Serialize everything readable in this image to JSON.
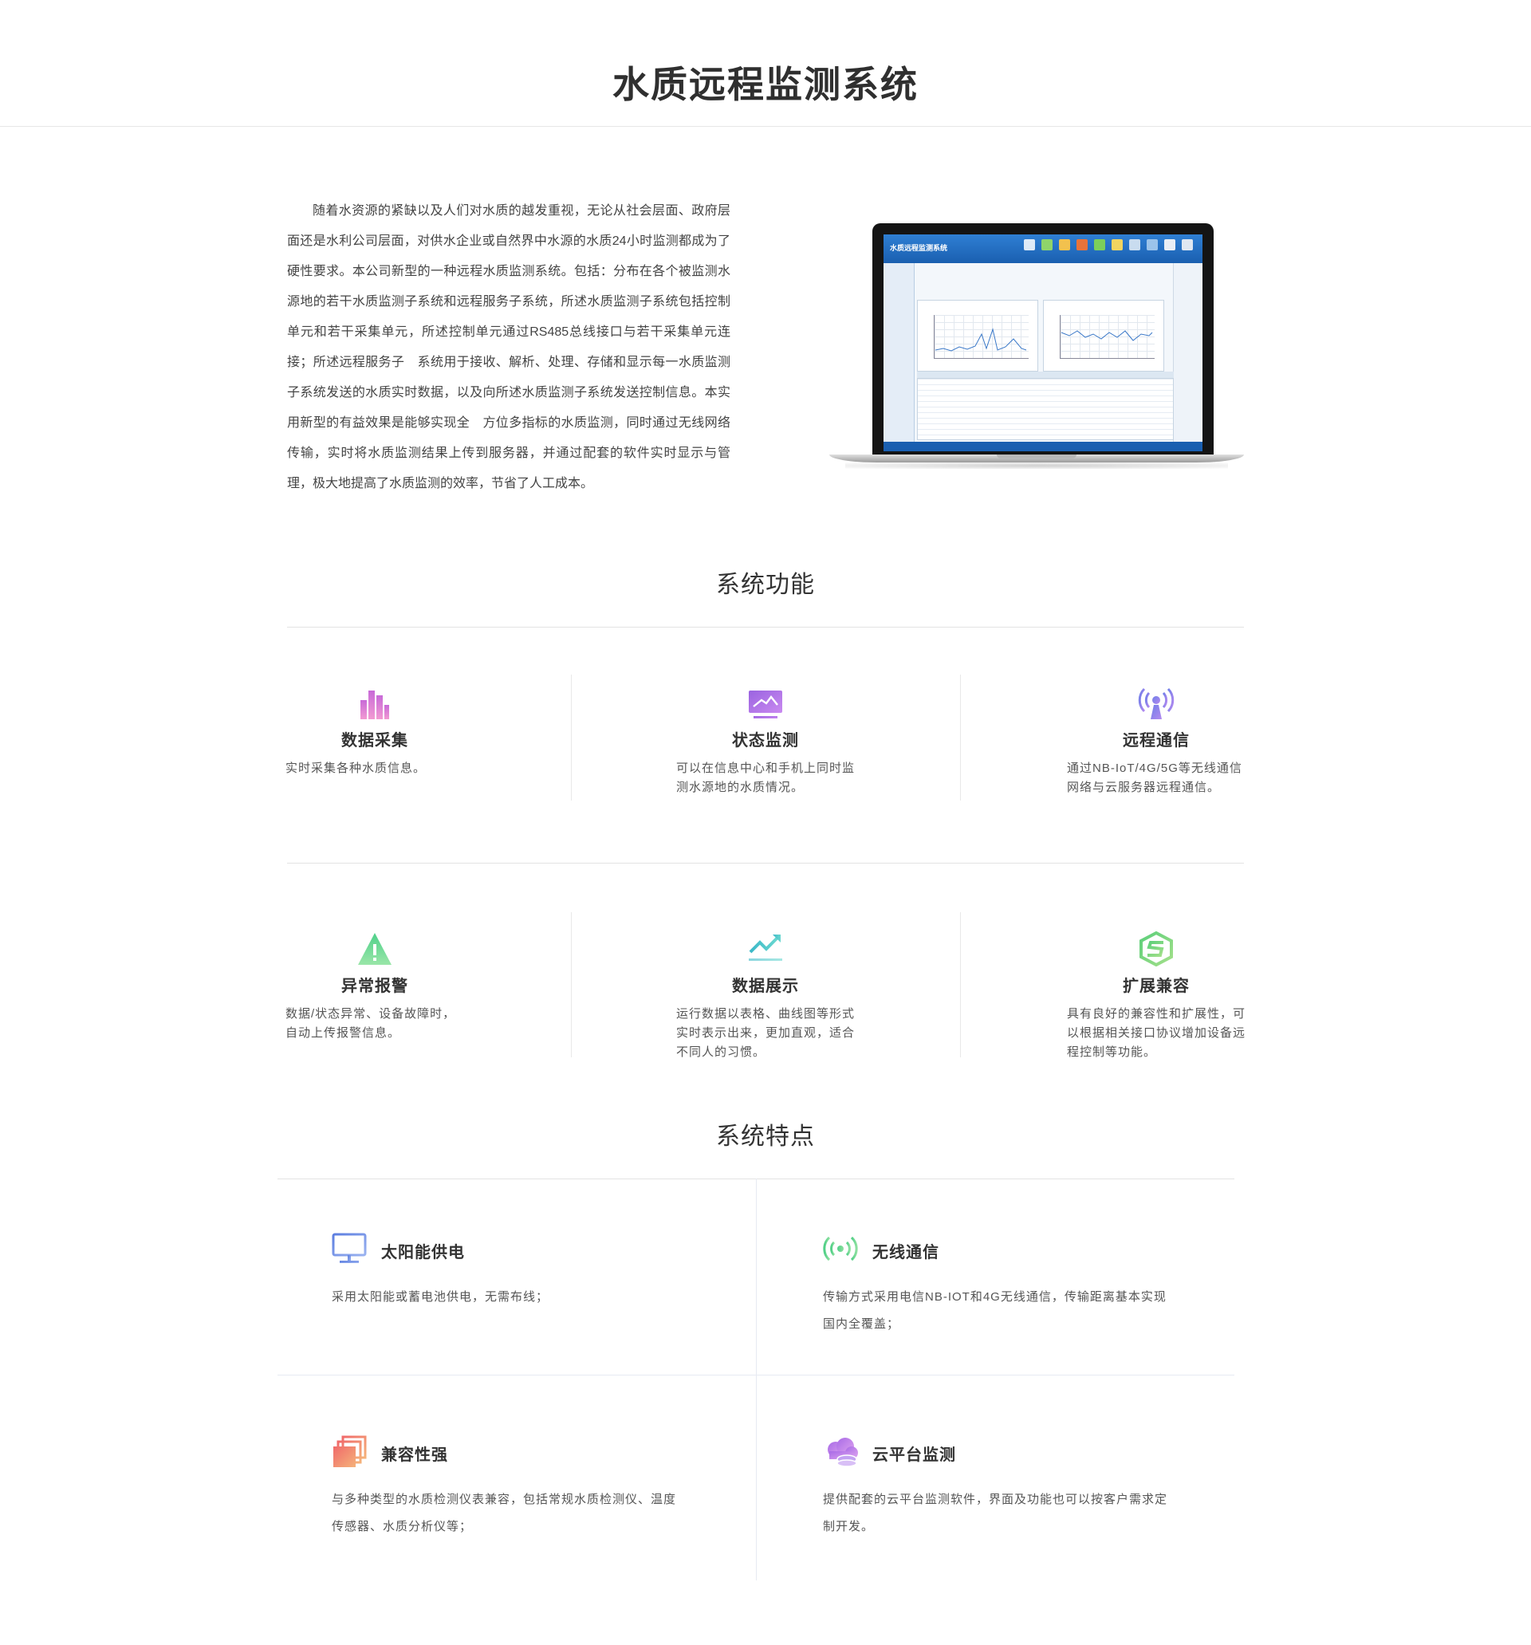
{
  "page_title": "水质远程监测系统",
  "intro_text": "随着水资源的紧缺以及人们对水质的越发重视，无论从社会层面、政府层面还是水利公司层面，对供水企业或自然界中水源的水质24小时监测都成为了硬性要求。本公司新型的一种远程水质监测系统。包括：分布在各个被监测水源地的若干水质监测子系统和远程服务子系统，所述水质监测子系统包括控制单元和若干采集单元，所述控制单元通过RS485总线接口与若干采集单元连接；所述远程服务子　系统用于接收、解析、处理、存储和显示每一水质监测子系统发送的水质实时数据，以及向所述水质监测子系统发送控制信息。本实用新型的有益效果是能够实现全　方位多指标的水质监测，同时通过无线网络传输，实时将水质监测结果上传到服务器，并通过配套的软件实时显示与管理，极大地提高了水质监测的效率，节省了人工成本。",
  "laptop_screen_title": "水质远程监测系统",
  "functions_title": "系统功能",
  "functions": [
    {
      "name": "数据采集",
      "desc": "实时采集各种水质信息。",
      "icon": "bar-chart-icon"
    },
    {
      "name": "状态监测",
      "desc": "可以在信息中心和手机上同时监测水源地的水质情况。",
      "icon": "monitor-icon"
    },
    {
      "name": "远程通信",
      "desc": "通过NB-IoT/4G/5G等无线通信网络与云服务器远程通信。",
      "icon": "antenna-icon"
    },
    {
      "name": "异常报警",
      "desc": "数据/状态异常、设备故障时，自动上传报警信息。",
      "icon": "warning-icon"
    },
    {
      "name": "数据展示",
      "desc": "运行数据以表格、曲线图等形式实时表示出来，更加直观，适合不同人的习惯。",
      "icon": "trend-line-icon"
    },
    {
      "name": "扩展兼容",
      "desc": "具有良好的兼容性和扩展性，可以根据相关接口协议增加设备远程控制等功能。",
      "icon": "hexagon-s-icon"
    }
  ],
  "features_title": "系统特点",
  "features": [
    {
      "name": "太阳能供电",
      "desc": "采用太阳能或蓄电池供电，无需布线；",
      "icon": "solar-panel-icon"
    },
    {
      "name": "无线通信",
      "desc": "传输方式采用电信NB-IOT和4G无线通信，传输距离基本实现国内全覆盖；",
      "icon": "wireless-icon"
    },
    {
      "name": "兼容性强",
      "desc": "与多种类型的水质检测仪表兼容，包括常规水质检测仪、温度传感器、水质分析仪等；",
      "icon": "stacked-layers-icon"
    },
    {
      "name": "云平台监测",
      "desc": "提供配套的云平台监测软件，界面及功能也可以按客户需求定制开发。",
      "icon": "cloud-icon"
    }
  ],
  "colors": {
    "func_pink": "#e07ad0",
    "func_purple": "#b06ae0",
    "func_blue": "#7c8ff0",
    "func_green": "#5fd68a",
    "func_teal": "#4ec8c0",
    "func_lime": "#72d07a",
    "feat_solar": "#6f8fe8",
    "feat_wireless": "#62d68d",
    "feat_layers": "#f08a6a",
    "feat_cloud": "#b67ae8"
  }
}
